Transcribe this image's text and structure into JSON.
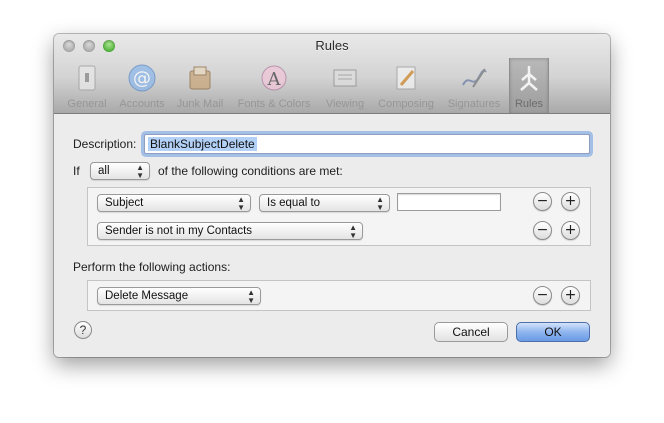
{
  "window": {
    "title": "Rules"
  },
  "toolbar": {
    "items": [
      {
        "label": "General",
        "icon": "general-icon"
      },
      {
        "label": "Accounts",
        "icon": "accounts-at-icon"
      },
      {
        "label": "Junk Mail",
        "icon": "junk-mail-icon"
      },
      {
        "label": "Fonts & Colors",
        "icon": "fonts-colors-icon"
      },
      {
        "label": "Viewing",
        "icon": "viewing-icon"
      },
      {
        "label": "Composing",
        "icon": "composing-icon"
      },
      {
        "label": "Signatures",
        "icon": "signatures-icon"
      },
      {
        "label": "Rules",
        "icon": "rules-icon",
        "selected": true
      }
    ]
  },
  "rule": {
    "description_label": "Description:",
    "description_value": "BlankSubjectDelete",
    "if_label": "If",
    "match_value": "all",
    "conditions_suffix": "of the following conditions are met:",
    "conditions": [
      {
        "field": "Subject",
        "operator": "Is equal to",
        "value": ""
      },
      {
        "field": "Sender is not in my Contacts"
      }
    ],
    "actions_label": "Perform the following actions:",
    "actions": [
      {
        "action": "Delete Message"
      }
    ]
  },
  "buttons": {
    "minus": "−",
    "plus": "+",
    "help": "?",
    "cancel": "Cancel",
    "ok": "OK"
  },
  "colors": {
    "accent": "#6a9be6",
    "selection": "#b3d1f7",
    "zoom_button": "#2f9e1d"
  }
}
